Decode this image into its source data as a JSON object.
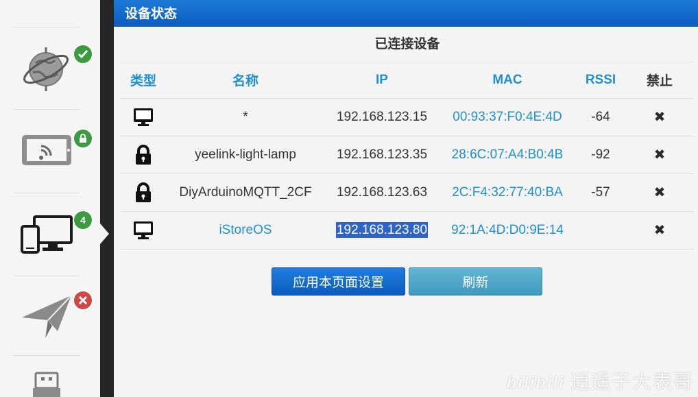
{
  "panel": {
    "title": "设备状态"
  },
  "section": {
    "title": "已连接设备"
  },
  "table": {
    "headers": {
      "type": "类型",
      "name": "名称",
      "ip": "IP",
      "mac": "MAC",
      "rssi": "RSSI",
      "ban": "禁止"
    },
    "rows": [
      {
        "type_icon": "monitor-icon",
        "name": "*",
        "ip": "192.168.123.15",
        "mac": "00:93:37:F0:4E:4D",
        "rssi": "-64"
      },
      {
        "type_icon": "lock-icon",
        "name": "yeelink-light-lamp",
        "ip": "192.168.123.35",
        "mac": "28:6C:07:A4:B0:4B",
        "rssi": "-92"
      },
      {
        "type_icon": "lock-icon",
        "name": "DiyArduinoMQTT_2CF",
        "ip": "192.168.123.63",
        "mac": "2C:F4:32:77:40:BA",
        "rssi": "-57"
      },
      {
        "type_icon": "monitor-icon",
        "name": "iStoreOS",
        "ip": "192.168.123.80",
        "mac": "92:1A:4D:D0:9E:14",
        "rssi": ""
      }
    ]
  },
  "buttons": {
    "apply": "应用本页面设置",
    "refresh": "刷新"
  },
  "sidebar": {
    "items": [
      {
        "icon": "internet-globe-icon",
        "badge_icon": "check-icon"
      },
      {
        "icon": "wireless-tablet-icon",
        "badge_icon": "lock-icon"
      },
      {
        "icon": "devices-icon",
        "badge": "4"
      },
      {
        "icon": "send-plane-icon",
        "badge_icon": "close-icon"
      },
      {
        "icon": "usb-icon"
      }
    ]
  },
  "watermark": {
    "logo": "bilibili",
    "text": "逍遥子大表哥"
  },
  "colors": {
    "accent": "#1e8fd0",
    "header": "#0b5cc0",
    "selection": "#2f63c6"
  }
}
